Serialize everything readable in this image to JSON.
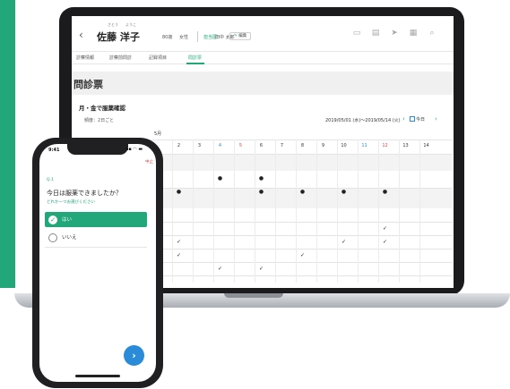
{
  "colors": {
    "accent": "#21a77a",
    "link_blue": "#2a8cd8",
    "sunday_red": "#e04545",
    "device_frame": "#1b1b1d"
  },
  "desktop": {
    "header": {
      "back_icon": "chevron-left-icon",
      "surname_kana": "さとう",
      "given_kana": "ようこ",
      "patient_name": "佐藤 洋子",
      "age": "80歳",
      "sex": "女性",
      "doctor_label": "担当医",
      "doctor_name": "田中 太郎",
      "edit_label": "編集",
      "action_icons": [
        "chat-icon",
        "document-icon",
        "send-icon",
        "calendar-icon",
        "search-icon"
      ]
    },
    "tabs": [
      "診察情報",
      "診察前問診",
      "記録項目",
      "問診票"
    ],
    "active_tab": 3,
    "page_title": "問診票",
    "section": {
      "title": "月・金で服薬確認",
      "frequency": "頻度：2日ごと",
      "date_range": "2019/05/01 (水)〜2019/05/14 (火)",
      "prev_icon": "‹",
      "next_icon": "›",
      "today_label": "今日"
    },
    "calendar": {
      "month": "5月",
      "days": [
        "2",
        "3",
        "4",
        "5",
        "6",
        "7",
        "8",
        "9",
        "10",
        "11",
        "12",
        "13",
        "14"
      ]
    }
  },
  "phone": {
    "status_time": "9:41",
    "status_icons": "▪▪ ◠ ▬",
    "cancel_label": "中止",
    "question_number": "Q.1",
    "question_text": "今日は服薬できましたか？",
    "question_hint": "どれか一つお選びください",
    "options": [
      "はい",
      "いいえ"
    ],
    "selected_option": 0,
    "next_icon": "›"
  }
}
